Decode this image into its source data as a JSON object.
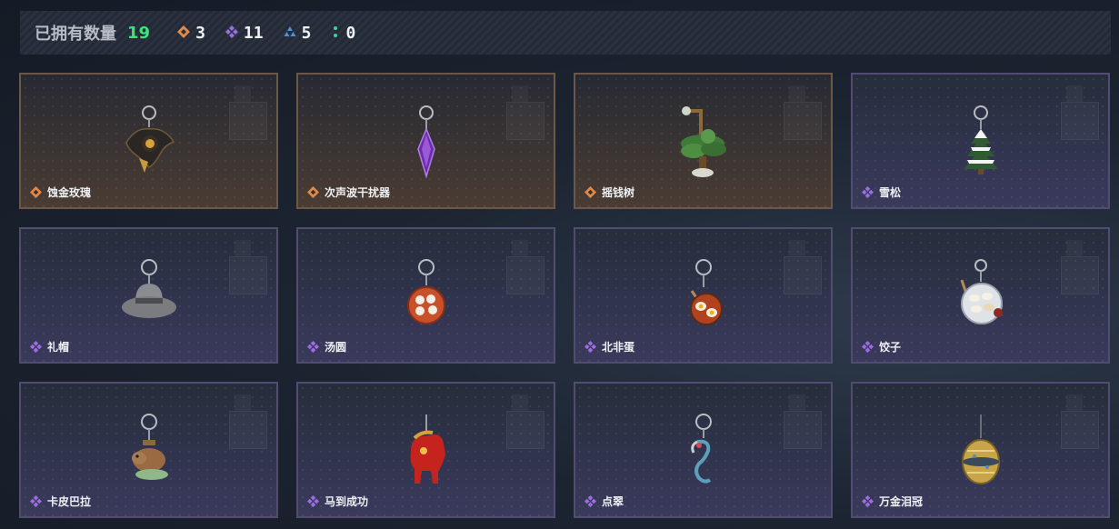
{
  "header": {
    "owned_label": "已拥有数量",
    "owned_total": "19",
    "rarity_counts": [
      {
        "rarity": "orange",
        "icon": "orange-diamond-rarity-icon",
        "color": "#e08a4a",
        "count": "3"
      },
      {
        "rarity": "purple",
        "icon": "purple-diamond-rarity-icon",
        "color": "#9a6ee0",
        "count": "11"
      },
      {
        "rarity": "blue",
        "icon": "blue-triangle-rarity-icon",
        "color": "#4f8fe0",
        "count": "5"
      },
      {
        "rarity": "green",
        "icon": "green-dots-rarity-icon",
        "color": "#3fd0a0",
        "count": "0"
      }
    ]
  },
  "items": [
    {
      "name": "蚀金玫瑰",
      "rarity": "orange",
      "icon": "golden-rose-charm-icon"
    },
    {
      "name": "次声波干扰器",
      "rarity": "orange",
      "icon": "infrasound-jammer-charm-icon"
    },
    {
      "name": "摇钱树",
      "rarity": "orange",
      "icon": "money-tree-charm-icon"
    },
    {
      "name": "雪松",
      "rarity": "purple",
      "icon": "snow-pine-charm-icon"
    },
    {
      "name": "礼帽",
      "rarity": "purple",
      "icon": "hat-charm-icon"
    },
    {
      "name": "汤圆",
      "rarity": "purple",
      "icon": "tangyuan-charm-icon"
    },
    {
      "name": "北非蛋",
      "rarity": "purple",
      "icon": "shakshuka-charm-icon"
    },
    {
      "name": "饺子",
      "rarity": "purple",
      "icon": "dumplings-charm-icon"
    },
    {
      "name": "卡皮巴拉",
      "rarity": "purple",
      "icon": "capybara-charm-icon"
    },
    {
      "name": "马到成功",
      "rarity": "purple",
      "icon": "horse-charm-icon"
    },
    {
      "name": "点翠",
      "rarity": "purple",
      "icon": "phoenix-charm-icon"
    },
    {
      "name": "万金泪冠",
      "rarity": "purple",
      "icon": "golden-crown-charm-icon"
    }
  ],
  "colors": {
    "total_green": "#3fe07e",
    "orange": "#e08a4a",
    "purple": "#9a6ee0"
  }
}
